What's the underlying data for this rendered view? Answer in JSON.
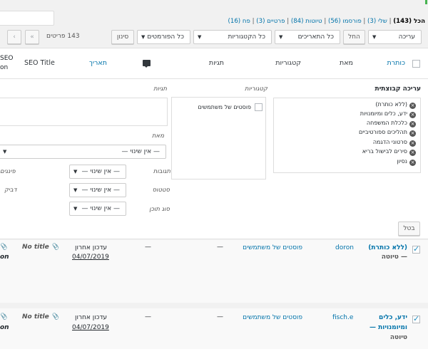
{
  "filters_nav": {
    "all": "הכל (143)",
    "mine": "שלי (3)",
    "published": "פורסמו (56)",
    "drafts": "טיוטות (84)",
    "private": "פרטיים (3)",
    "trash": "פח (16)"
  },
  "toolbar": {
    "bulk_action": "עריכה",
    "apply": "החל",
    "dates": "כל התאריכים",
    "categories": "כל הקטגוריות",
    "formats": "כל הפורמטים",
    "filter": "סינון",
    "items_count": "143 פריטים",
    "first_page": "«",
    "prev_page": "‹"
  },
  "columns": {
    "title": "כותרת",
    "author": "מאת",
    "categories": "קטגוריות",
    "tags": "תגיות",
    "comments_icon": "comment-icon",
    "date": "תאריך",
    "seo_title": "SEO Title",
    "seo_cut1": "SEO",
    "seo_cut2": "on"
  },
  "bulk_edit": {
    "heading": "עריכה קבוצתית",
    "categories_label": "קטגוריות",
    "tags_label": "תגיות",
    "author_label": "מאת",
    "no_change": "— אין שינוי —",
    "comments_label": "תגובות",
    "status_label": "סטטוס",
    "format_label": "סוג תוכן",
    "pings_label": "פינגים",
    "sticky_label": "דביק",
    "cancel": "בטל",
    "category_option": "פוסטים של משתמשים",
    "titles": [
      "(ללא כותרת)",
      "ידע, כלים ומיומנויות",
      "כלכלת המשפחה",
      "תהליכים ספורטיביים",
      "סרטוני הדגמה",
      "סירים לבישול בריא",
      "נסיון"
    ]
  },
  "rows": [
    {
      "title": "(ללא כותרת)",
      "state": "— טיוטה",
      "author": "doron",
      "category": "פוסטים של משתמשים",
      "tags": "—",
      "comments": "—",
      "date_label": "עדכון אחרון",
      "date": "04/07/2019",
      "seo": "No title",
      "edge": "on"
    },
    {
      "title_line1": "ידע, כלים",
      "title_line2": "ומיומנויות —",
      "state": "טיוטה",
      "author": "fisch.e",
      "category": "פוסטים של משתמשים",
      "tags": "—",
      "comments": "—",
      "date_label": "עדכון אחרון",
      "date": "04/07/2019",
      "seo": "No title",
      "edge": "on"
    }
  ],
  "colors": {
    "link": "#0073aa",
    "accent_green": "#46b450",
    "row_bg": "#f9f9f9"
  }
}
